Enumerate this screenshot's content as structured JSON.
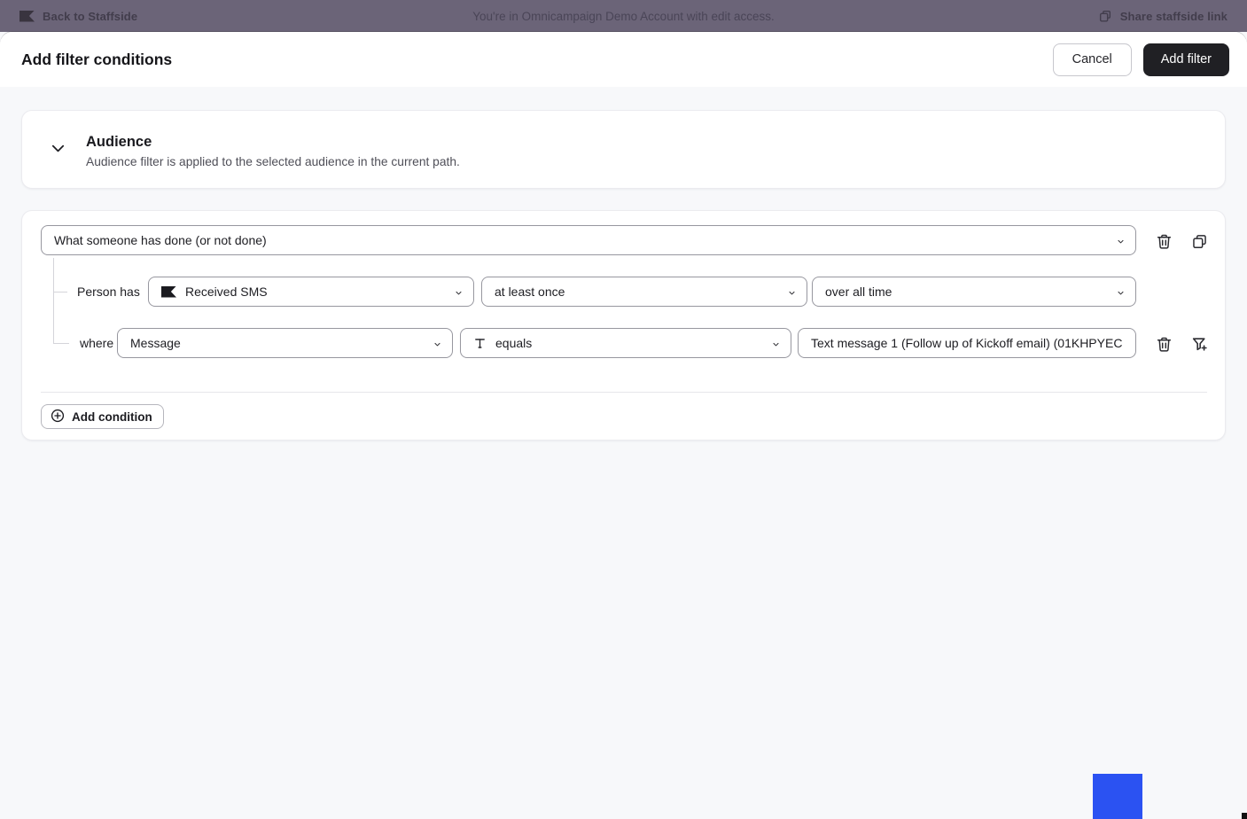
{
  "topbar": {
    "back_label": "Back to Staffside",
    "center_text": "You're in Omnicampaign Demo Account with edit access.",
    "share_label": "Share staffside link"
  },
  "modal": {
    "title": "Add filter conditions",
    "cancel_label": "Cancel",
    "add_filter_label": "Add filter"
  },
  "audience_section": {
    "title": "Audience",
    "description": "Audience filter is applied to the selected audience in the current path."
  },
  "filter": {
    "type_selector_value": "What someone has done (or not done)",
    "person_has_label": "Person has",
    "event_value": "Received SMS",
    "frequency_value": "at least once",
    "timeframe_value": "over all time",
    "where_label": "where",
    "property_value": "Message",
    "operator_value": "equals",
    "value_text": "Text message 1 (Follow up of Kickoff email) (01KHPYEC",
    "add_condition_label": "Add condition"
  },
  "icons": {
    "back": "klaviyo-flag-icon",
    "share": "copy-icon",
    "section_toggle": "chevron-down-icon",
    "event_lead": "klaviyo-flag-icon",
    "operator_lead": "text-type-icon",
    "row_actions": [
      "trash-icon",
      "duplicate-icon"
    ],
    "condition_actions": [
      "trash-icon",
      "filter-plus-icon"
    ],
    "add_condition": "plus-circle-icon"
  },
  "colors": {
    "topbar_bg": "#6b6478",
    "body_bg": "#f7f8fa",
    "primary_button_bg": "#202024",
    "input_border": "#97979f",
    "artifact_blue": "#2b52f2"
  }
}
